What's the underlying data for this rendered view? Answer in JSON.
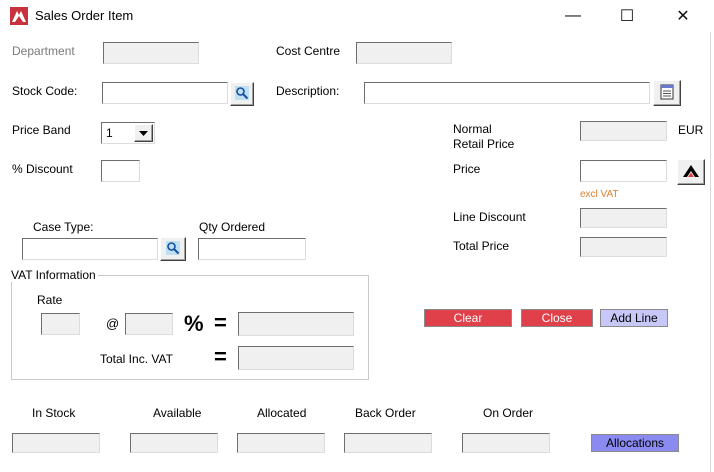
{
  "window": {
    "title": "Sales Order Item",
    "minimize": "—",
    "maximize": "☐",
    "close": "✕"
  },
  "fields": {
    "department": {
      "label": "Department",
      "value": ""
    },
    "cost_centre": {
      "label": "Cost Centre",
      "value": ""
    },
    "stock_code": {
      "label": "Stock Code:",
      "value": ""
    },
    "description": {
      "label": "Description:",
      "value": ""
    },
    "price_band": {
      "label": "Price Band",
      "value": "1"
    },
    "discount": {
      "label": "% Discount",
      "value": ""
    },
    "normal_retail_price": {
      "label_line1": "Normal",
      "label_line2": "Retail Price",
      "value": "",
      "currency": "EUR"
    },
    "price": {
      "label": "Price",
      "value": "",
      "note": "excl VAT"
    },
    "line_discount": {
      "label": "Line Discount",
      "value": ""
    },
    "total_price": {
      "label": "Total Price",
      "value": ""
    },
    "case_type": {
      "label": "Case Type:",
      "value": ""
    },
    "qty_ordered": {
      "label": "Qty Ordered",
      "value": ""
    }
  },
  "vat": {
    "group_label": "VAT Information",
    "rate_label": "Rate",
    "at_symbol": "@",
    "percent_symbol": "%",
    "equals_symbol": "=",
    "total_inc_vat_label": "Total Inc. VAT"
  },
  "buttons": {
    "clear": "Clear",
    "close": "Close",
    "add_line": "Add Line",
    "allocations": "Allocations"
  },
  "stock_columns": [
    {
      "label": "In Stock",
      "value": ""
    },
    {
      "label": "Available",
      "value": ""
    },
    {
      "label": "Allocated",
      "value": ""
    },
    {
      "label": "Back Order",
      "value": ""
    },
    {
      "label": "On Order",
      "value": ""
    }
  ],
  "colors": {
    "red_button": "#e0404a",
    "lavender_button": "#c8c8f8",
    "purple_button": "#8a8af0",
    "excl_vat_note": "#e08030"
  }
}
